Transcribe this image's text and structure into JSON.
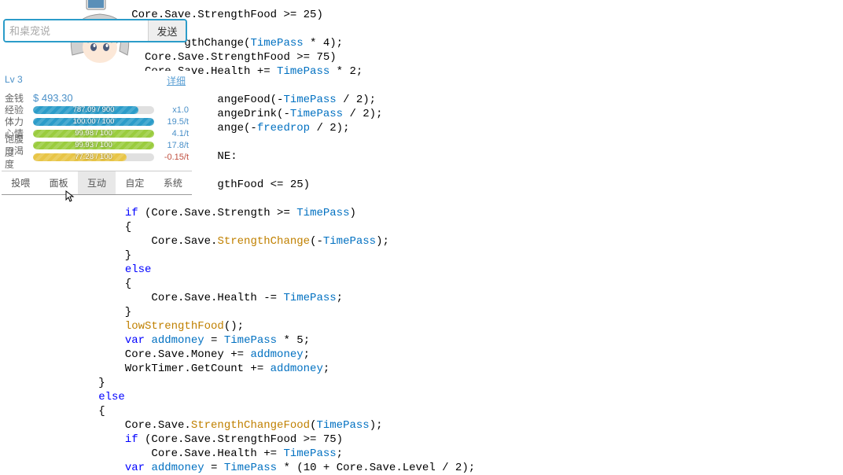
{
  "chat": {
    "placeholder": "和桌宠说",
    "send_label": "发送"
  },
  "stats": {
    "level_label": "Lv 3",
    "detail_label": "详细",
    "rows": {
      "money": {
        "label": "金钱",
        "value": "$ 493.30"
      },
      "exp": {
        "label": "经验",
        "bar_text": "787.09 / 900",
        "fill": 87,
        "color": "bar-blue",
        "rate": "x1.0"
      },
      "stam": {
        "label": "体力",
        "bar_text": "100.00 / 100",
        "fill": 100,
        "color": "bar-blue",
        "rate": "19.5/t"
      },
      "mood": {
        "label": "心情",
        "bar_text": "99.98 / 100",
        "fill": 100,
        "color": "bar-green",
        "rate": "4.1/t"
      },
      "food": {
        "label": "饱腹度",
        "bar_text": "99.93 / 100",
        "fill": 100,
        "color": "bar-green",
        "rate": "17.8/t"
      },
      "drink": {
        "label": "口渴度",
        "bar_text": "77.28 / 100",
        "fill": 77,
        "color": "bar-yellow",
        "rate": "-0.15/t",
        "rate_neg": true
      }
    }
  },
  "tabs": {
    "feed": "投喂",
    "panel": "面板",
    "act": "互动",
    "custom": "自定",
    "system": "系统"
  },
  "code": [
    {
      "segs": [
        {
          "t": "        Core.Save.StrengthFood >= 25)"
        }
      ]
    },
    {
      "segs": [
        {
          "t": ""
        }
      ]
    },
    {
      "segs": [
        {
          "t": "                gthChange("
        },
        {
          "t": "TimePass",
          "c": "param"
        },
        {
          "t": " * 4);"
        }
      ]
    },
    {
      "segs": [
        {
          "t": "          Core.Save.StrengthFood >= 75)"
        }
      ]
    },
    {
      "segs": [
        {
          "t": "          Core.Save.Health += "
        },
        {
          "t": "TimePass",
          "c": "param"
        },
        {
          "t": " * 2;"
        }
      ]
    },
    {
      "segs": [
        {
          "t": ""
        }
      ]
    },
    {
      "segs": [
        {
          "t": "                     angeFood(-"
        },
        {
          "t": "TimePass",
          "c": "param"
        },
        {
          "t": " / 2);"
        }
      ]
    },
    {
      "segs": [
        {
          "t": "                     angeDrink(-"
        },
        {
          "t": "TimePass",
          "c": "param"
        },
        {
          "t": " / 2);"
        }
      ]
    },
    {
      "segs": [
        {
          "t": "                     ange(-"
        },
        {
          "t": "freedrop",
          "c": "param"
        },
        {
          "t": " / 2);"
        }
      ]
    },
    {
      "segs": [
        {
          "t": ""
        }
      ]
    },
    {
      "segs": [
        {
          "t": "                     NE:"
        }
      ]
    },
    {
      "segs": [
        {
          "t": ""
        }
      ]
    },
    {
      "segs": [
        {
          "t": "                     gthFood <= 25)"
        }
      ]
    },
    {
      "segs": [
        {
          "t": ""
        }
      ]
    },
    {
      "segs": [
        {
          "t": "       ",
          "c": null
        },
        {
          "t": "if",
          "c": "kw"
        },
        {
          "t": " (Core.Save.Strength >= "
        },
        {
          "t": "TimePass",
          "c": "param"
        },
        {
          "t": ")"
        }
      ]
    },
    {
      "segs": [
        {
          "t": "       {"
        }
      ]
    },
    {
      "segs": [
        {
          "t": "           Core.Save."
        },
        {
          "t": "StrengthChange",
          "c": "method"
        },
        {
          "t": "(-"
        },
        {
          "t": "TimePass",
          "c": "param"
        },
        {
          "t": ");"
        }
      ]
    },
    {
      "segs": [
        {
          "t": "       }"
        }
      ]
    },
    {
      "segs": [
        {
          "t": "       "
        },
        {
          "t": "else",
          "c": "kw"
        }
      ]
    },
    {
      "segs": [
        {
          "t": "       {"
        }
      ]
    },
    {
      "segs": [
        {
          "t": "           Core.Save.Health -= "
        },
        {
          "t": "TimePass",
          "c": "param"
        },
        {
          "t": ";"
        }
      ]
    },
    {
      "segs": [
        {
          "t": "       }"
        }
      ]
    },
    {
      "segs": [
        {
          "t": "       "
        },
        {
          "t": "lowStrengthFood",
          "c": "method"
        },
        {
          "t": "();"
        }
      ]
    },
    {
      "segs": [
        {
          "t": "       "
        },
        {
          "t": "var",
          "c": "kw"
        },
        {
          "t": " "
        },
        {
          "t": "addmoney",
          "c": "param"
        },
        {
          "t": " = "
        },
        {
          "t": "TimePass",
          "c": "param"
        },
        {
          "t": " * 5;"
        }
      ]
    },
    {
      "segs": [
        {
          "t": "       Core.Save.Money += "
        },
        {
          "t": "addmoney",
          "c": "param"
        },
        {
          "t": ";"
        }
      ]
    },
    {
      "segs": [
        {
          "t": "       WorkTimer.GetCount += "
        },
        {
          "t": "addmoney",
          "c": "param"
        },
        {
          "t": ";"
        }
      ]
    },
    {
      "segs": [
        {
          "t": "   }"
        }
      ]
    },
    {
      "segs": [
        {
          "t": "   "
        },
        {
          "t": "else",
          "c": "kw"
        }
      ]
    },
    {
      "segs": [
        {
          "t": "   {"
        }
      ]
    },
    {
      "segs": [
        {
          "t": "       Core.Save."
        },
        {
          "t": "StrengthChangeFood",
          "c": "method"
        },
        {
          "t": "("
        },
        {
          "t": "TimePass",
          "c": "param"
        },
        {
          "t": ");"
        }
      ]
    },
    {
      "segs": [
        {
          "t": "       "
        },
        {
          "t": "if",
          "c": "kw"
        },
        {
          "t": " (Core.Save.StrengthFood >= 75)"
        }
      ]
    },
    {
      "segs": [
        {
          "t": "           Core.Save.Health += "
        },
        {
          "t": "TimePass",
          "c": "param"
        },
        {
          "t": ";"
        }
      ]
    },
    {
      "segs": [
        {
          "t": "       "
        },
        {
          "t": "var",
          "c": "kw"
        },
        {
          "t": " "
        },
        {
          "t": "addmoney",
          "c": "param"
        },
        {
          "t": " = "
        },
        {
          "t": "TimePass",
          "c": "param"
        },
        {
          "t": " * (10 + Core.Save.Level / 2);"
        }
      ]
    }
  ]
}
